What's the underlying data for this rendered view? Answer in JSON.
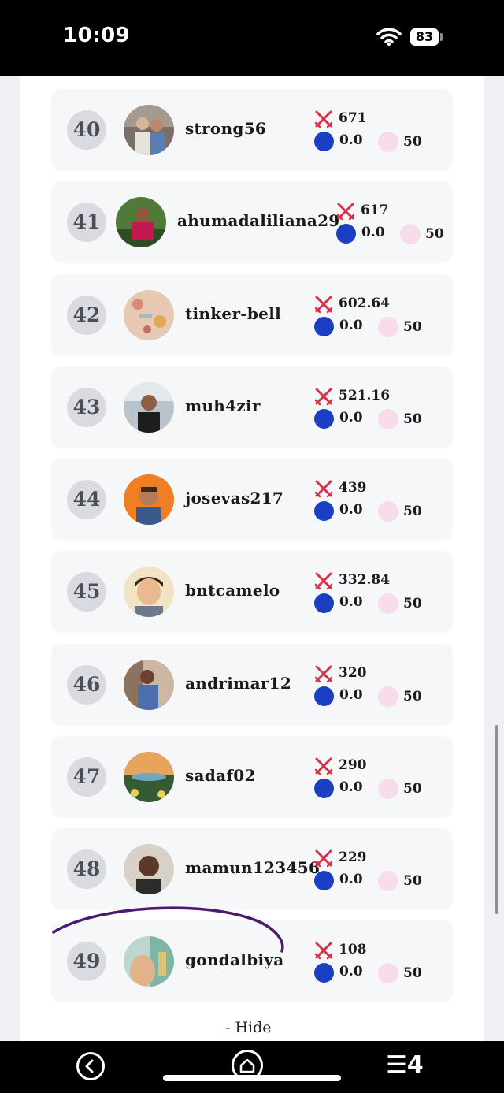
{
  "status_bar": {
    "time": "10:09",
    "battery": "83"
  },
  "rows": [
    {
      "rank": "40",
      "username": "strong56",
      "score": "671",
      "steem": "0.0",
      "chars": "50"
    },
    {
      "rank": "41",
      "username": "ahumadaliliana29",
      "score": "617",
      "steem": "0.0",
      "chars": "50"
    },
    {
      "rank": "42",
      "username": "tinker-bell",
      "score": "602.64",
      "steem": "0.0",
      "chars": "50"
    },
    {
      "rank": "43",
      "username": "muh4zir",
      "score": "521.16",
      "steem": "0.0",
      "chars": "50"
    },
    {
      "rank": "44",
      "username": "josevas217",
      "score": "439",
      "steem": "0.0",
      "chars": "50"
    },
    {
      "rank": "45",
      "username": "bntcamelo",
      "score": "332.84",
      "steem": "0.0",
      "chars": "50"
    },
    {
      "rank": "46",
      "username": "andrimar12",
      "score": "320",
      "steem": "0.0",
      "chars": "50"
    },
    {
      "rank": "47",
      "username": "sadaf02",
      "score": "290",
      "steem": "0.0",
      "chars": "50"
    },
    {
      "rank": "48",
      "username": "mamun123456",
      "score": "229",
      "steem": "0.0",
      "chars": "50"
    },
    {
      "rank": "49",
      "username": "gondalbiya",
      "score": "108",
      "steem": "0.0",
      "chars": "50"
    }
  ],
  "hide_label": "- Hide",
  "nav": {
    "tabs_count": "4"
  },
  "colors": {
    "accent_steem": "#1a3fc2",
    "swords": "#d9304a",
    "annotation": "#4b1a6e"
  }
}
